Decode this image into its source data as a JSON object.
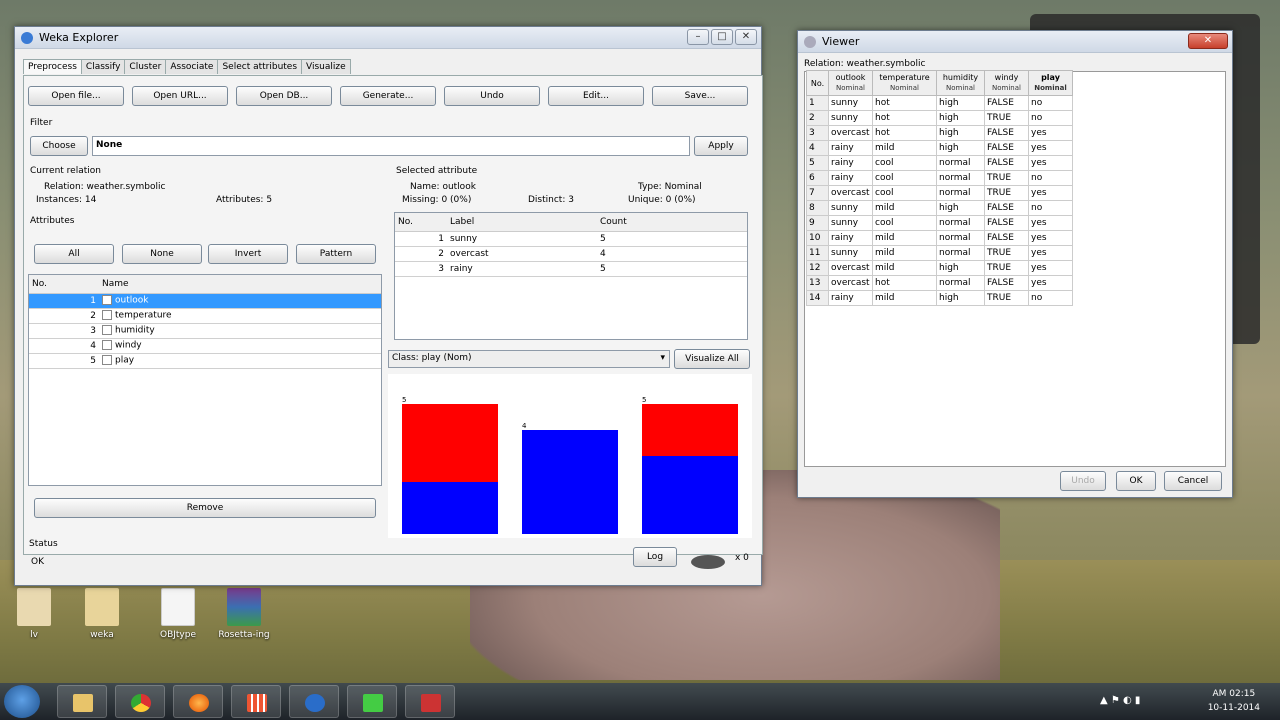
{
  "desktop": {
    "icons": [
      {
        "label": "lv"
      },
      {
        "label": "weka"
      },
      {
        "label": "OBJtype"
      },
      {
        "label": "Rosetta-ing"
      }
    ]
  },
  "weka": {
    "title": "Weka Explorer",
    "tabs": [
      "Preprocess",
      "Classify",
      "Cluster",
      "Associate",
      "Select attributes",
      "Visualize"
    ],
    "toolbar": [
      "Open file...",
      "Open URL...",
      "Open DB...",
      "Generate...",
      "Undo",
      "Edit...",
      "Save..."
    ],
    "filter": {
      "heading": "Filter",
      "choose": "Choose",
      "value": "None",
      "apply": "Apply"
    },
    "current_relation": {
      "heading": "Current relation",
      "relation": "Relation: weather.symbolic",
      "instances": "Instances: 14",
      "attributes": "Attributes: 5"
    },
    "attributes": {
      "heading": "Attributes",
      "buttons": [
        "All",
        "None",
        "Invert",
        "Pattern"
      ],
      "col_no": "No.",
      "col_name": "Name",
      "rows": [
        {
          "no": "1",
          "name": "outlook"
        },
        {
          "no": "2",
          "name": "temperature"
        },
        {
          "no": "3",
          "name": "humidity"
        },
        {
          "no": "4",
          "name": "windy"
        },
        {
          "no": "5",
          "name": "play"
        }
      ],
      "remove": "Remove"
    },
    "selected": {
      "heading": "Selected attribute",
      "name": "Name: outlook",
      "type": "Type: Nominal",
      "missing": "Missing: 0 (0%)",
      "distinct": "Distinct: 3",
      "unique": "Unique: 0 (0%)",
      "cols": [
        "No.",
        "Label",
        "Count"
      ],
      "rows": [
        {
          "no": "1",
          "label": "sunny",
          "count": "5"
        },
        {
          "no": "2",
          "label": "overcast",
          "count": "4"
        },
        {
          "no": "3",
          "label": "rainy",
          "count": "5"
        }
      ]
    },
    "class_select": "Class: play (Nom)",
    "visualize_all": "Visualize All",
    "status": {
      "heading": "Status",
      "text": "OK",
      "log": "Log",
      "count": "x 0"
    }
  },
  "chart_data": {
    "type": "bar",
    "categories": [
      "sunny",
      "overcast",
      "rainy"
    ],
    "series": [
      {
        "name": "yes",
        "values": [
          2,
          4,
          3
        ]
      },
      {
        "name": "no",
        "values": [
          3,
          0,
          2
        ]
      }
    ],
    "totals": [
      "5",
      "4",
      "5"
    ],
    "colors": {
      "yes": "#0000ff",
      "no": "#ff0000"
    }
  },
  "viewer": {
    "title": "Viewer",
    "relation": "Relation: weather.symbolic",
    "headers": [
      {
        "name": "No.",
        "type": ""
      },
      {
        "name": "outlook",
        "type": "Nominal"
      },
      {
        "name": "temperature",
        "type": "Nominal"
      },
      {
        "name": "humidity",
        "type": "Nominal"
      },
      {
        "name": "windy",
        "type": "Nominal"
      },
      {
        "name": "play",
        "type": "Nominal"
      }
    ],
    "rows": [
      [
        "1",
        "sunny",
        "hot",
        "high",
        "FALSE",
        "no"
      ],
      [
        "2",
        "sunny",
        "hot",
        "high",
        "TRUE",
        "no"
      ],
      [
        "3",
        "overcast",
        "hot",
        "high",
        "FALSE",
        "yes"
      ],
      [
        "4",
        "rainy",
        "mild",
        "high",
        "FALSE",
        "yes"
      ],
      [
        "5",
        "rainy",
        "cool",
        "normal",
        "FALSE",
        "yes"
      ],
      [
        "6",
        "rainy",
        "cool",
        "normal",
        "TRUE",
        "no"
      ],
      [
        "7",
        "overcast",
        "cool",
        "normal",
        "TRUE",
        "yes"
      ],
      [
        "8",
        "sunny",
        "mild",
        "high",
        "FALSE",
        "no"
      ],
      [
        "9",
        "sunny",
        "cool",
        "normal",
        "FALSE",
        "yes"
      ],
      [
        "10",
        "rainy",
        "mild",
        "normal",
        "FALSE",
        "yes"
      ],
      [
        "11",
        "sunny",
        "mild",
        "normal",
        "TRUE",
        "yes"
      ],
      [
        "12",
        "overcast",
        "mild",
        "high",
        "TRUE",
        "yes"
      ],
      [
        "13",
        "overcast",
        "hot",
        "normal",
        "FALSE",
        "yes"
      ],
      [
        "14",
        "rainy",
        "mild",
        "high",
        "TRUE",
        "no"
      ]
    ],
    "buttons": {
      "undo": "Undo",
      "ok": "OK",
      "cancel": "Cancel"
    }
  },
  "taskbar": {
    "clock_time": "AM 02:15",
    "clock_date": "10-11-2014"
  }
}
